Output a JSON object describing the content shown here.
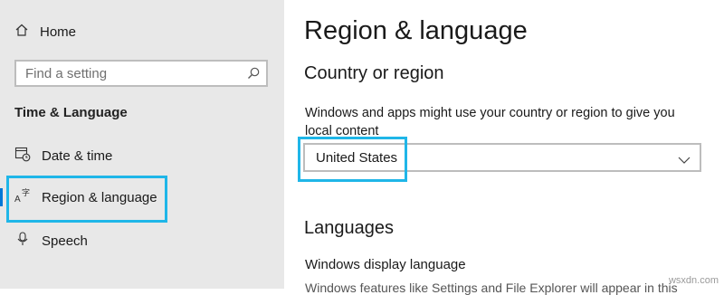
{
  "sidebar": {
    "home_label": "Home",
    "search_placeholder": "Find a setting",
    "section_title": "Time & Language",
    "items": [
      {
        "label": "Date & time",
        "icon": "calendar-clock-icon"
      },
      {
        "label": "Region & language",
        "icon": "language-icon",
        "selected": true
      },
      {
        "label": "Speech",
        "icon": "microphone-icon"
      }
    ]
  },
  "main": {
    "title": "Region & language",
    "country_heading": "Country or region",
    "country_desc": "Windows and apps might use your country or region to give you local content",
    "country_value": "United States",
    "languages_heading": "Languages",
    "display_language_label": "Windows display language",
    "display_language_desc_partial": "Windows features like Settings and File Explorer will appear in this"
  },
  "watermark": "wsxdn.com",
  "colors": {
    "sidebar_bg": "#e8e8e8",
    "highlight": "#1fb6e8",
    "selected_accent": "#0078d7"
  }
}
